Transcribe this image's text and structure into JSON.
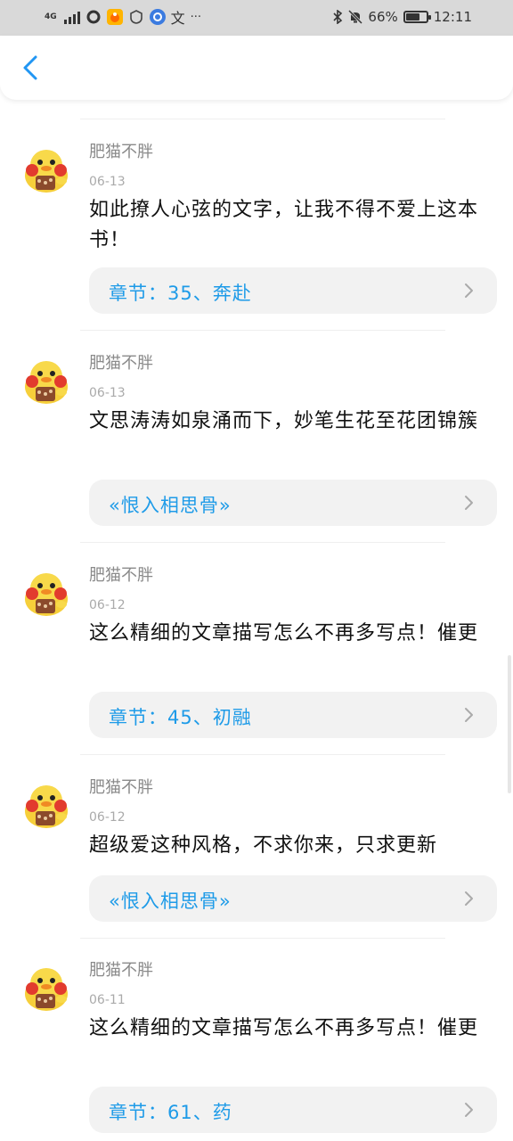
{
  "status_bar": {
    "network": "4G",
    "battery": "66%",
    "battery_level": 0.66,
    "time": "12:11",
    "icons": [
      "signal-icon",
      "circle-app-icon",
      "app-orange-icon",
      "app-shield-icon",
      "app-blue-icon",
      "translate-icon",
      "more-icon",
      "bluetooth-icon",
      "mute-icon",
      "battery-icon"
    ],
    "translate_glyph": "文",
    "more_glyph": "···"
  },
  "header": {
    "back_icon": "chevron-left-icon",
    "accent": "#2196f3"
  },
  "comments": [
    {
      "user": "肥猫不胖",
      "date": "06-13",
      "text": "如此撩人心弦的文字，让我不得不爱上这本书！",
      "ref": "章节：35、奔赴"
    },
    {
      "user": "肥猫不胖",
      "date": "06-13",
      "text": "文思涛涛如泉涌而下，妙笔生花至花团锦簇",
      "ref": "«恨入相思骨»"
    },
    {
      "user": "肥猫不胖",
      "date": "06-12",
      "text": "这么精细的文章描写怎么不再多写点！催更",
      "ref": "章节：45、初融"
    },
    {
      "user": "肥猫不胖",
      "date": "06-12",
      "text": "超级爱这种风格，不求你来，只求更新",
      "ref": "«恨入相思骨»"
    },
    {
      "user": "肥猫不胖",
      "date": "06-11",
      "text": "这么精细的文章描写怎么不再多写点！催更",
      "ref": "章节：61、药"
    }
  ],
  "colors": {
    "ref_text": "#1e9be8",
    "card_bg": "#f2f2f2"
  }
}
